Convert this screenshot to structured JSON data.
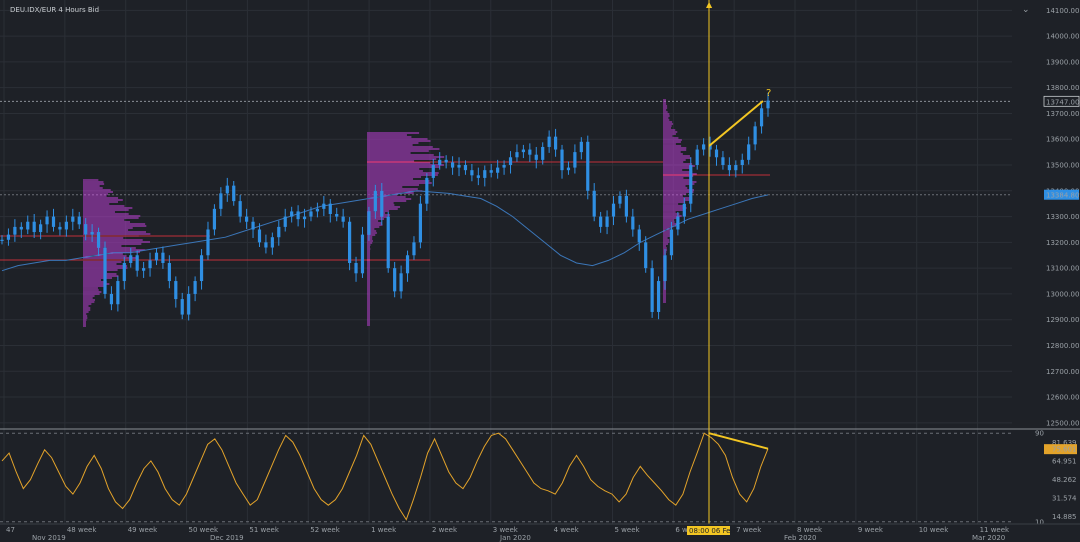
{
  "header": {
    "title": "DEU.IDX/EUR   4 Hours Bid"
  },
  "colors": {
    "background": "#1e2127",
    "grid": "#2b2f36",
    "price": "#2f8fe3",
    "ma": "#3b76b8",
    "volume_profile": "#b23ec9",
    "oscillator": "#e3a32a",
    "annotation": "#f3c623",
    "level_line": "#c0303a"
  },
  "annotation": {
    "question_mark": "?",
    "crosshair_date": "08:00 06 Feb."
  },
  "chart_data": [
    {
      "type": "line",
      "y_ticks": [
        "14100.00",
        "14000.00",
        "13900.00",
        "13800.00",
        "13700.00",
        "13600.00",
        "13500.00",
        "13400.00",
        "13300.00",
        "13200.00",
        "13100.00",
        "13000.00",
        "12900.00",
        "12800.00",
        "12700.00",
        "12600.00",
        "12500.00"
      ],
      "ylim": [
        12480,
        14140
      ],
      "price_labels": {
        "last": "13747.000",
        "ma": "13384.809"
      },
      "x_week_labels": [
        "47",
        "48 week",
        "49 week",
        "50 week",
        "51 week",
        "52 week",
        "1 week",
        "2 week",
        "3 week",
        "4 week",
        "5 week",
        "6 week",
        "7 week",
        "8 week",
        "9 week",
        "10 week",
        "11 week"
      ],
      "x_month_labels": [
        "Nov 2019",
        "Dec 2019",
        "Jan 2020",
        "Feb 2020",
        "Mar 2020"
      ],
      "series": [
        {
          "values": [
            13210,
            13230,
            13260,
            13250,
            13280,
            13240,
            13270,
            13300,
            13260,
            13250,
            13280,
            13300,
            13270,
            13230,
            13240,
            13180,
            13000,
            12960,
            13050,
            13120,
            13150,
            13090,
            13100,
            13130,
            13160,
            13120,
            13050,
            12980,
            12920,
            13000,
            13050,
            13150,
            13250,
            13330,
            13390,
            13420,
            13360,
            13300,
            13280,
            13250,
            13200,
            13180,
            13220,
            13260,
            13300,
            13320,
            13290,
            13300,
            13320,
            13330,
            13350,
            13310,
            13300,
            13280,
            13120,
            13080,
            13230,
            13320,
            13400,
            13300,
            13100,
            13010,
            13080,
            13150,
            13200,
            13350,
            13450,
            13500,
            13520,
            13510,
            13490,
            13500,
            13480,
            13460,
            13450,
            13480,
            13470,
            13490,
            13500,
            13530,
            13550,
            13560,
            13540,
            13520,
            13570,
            13610,
            13560,
            13480,
            13490,
            13550,
            13590,
            13400,
            13300,
            13260,
            13300,
            13350,
            13380,
            13300,
            13250,
            13200,
            13100,
            12930,
            13050,
            13150,
            13250,
            13300,
            13350,
            13500,
            13560,
            13580,
            13560,
            13530,
            13500,
            13480,
            13500,
            13520,
            13580,
            13650,
            13720,
            13750
          ]
        },
        {
          "values": [
            13090,
            13110,
            13120,
            13130,
            13130,
            13140,
            13150,
            13160,
            13160,
            13170,
            13180,
            13190,
            13200,
            13210,
            13220,
            13240,
            13260,
            13280,
            13300,
            13320,
            13340,
            13350,
            13360,
            13370,
            13380,
            13390,
            13400,
            13395,
            13390,
            13380,
            13370,
            13340,
            13300,
            13250,
            13200,
            13150,
            13120,
            13110,
            13130,
            13160,
            13200,
            13230,
            13260,
            13290,
            13310,
            13330,
            13350,
            13370,
            13384
          ]
        }
      ]
    },
    {
      "type": "line",
      "y_ticks": [
        "90",
        "81.639",
        "75.601",
        "64.951",
        "48.262",
        "31.574",
        "14.885",
        "10"
      ],
      "ylim": [
        8,
        92
      ],
      "current_value": "75.601",
      "series": [
        {
          "values": [
            65,
            72,
            55,
            40,
            48,
            62,
            75,
            68,
            55,
            42,
            35,
            45,
            60,
            70,
            58,
            40,
            28,
            22,
            30,
            45,
            58,
            65,
            55,
            40,
            30,
            25,
            35,
            50,
            65,
            80,
            85,
            75,
            60,
            45,
            35,
            25,
            30,
            45,
            60,
            75,
            88,
            82,
            70,
            55,
            40,
            30,
            25,
            30,
            40,
            55,
            70,
            88,
            80,
            65,
            50,
            35,
            22,
            12,
            30,
            50,
            72,
            85,
            70,
            55,
            45,
            40,
            50,
            65,
            78,
            88,
            90,
            85,
            75,
            65,
            55,
            45,
            40,
            38,
            35,
            45,
            60,
            70,
            60,
            48,
            42,
            38,
            35,
            28,
            35,
            50,
            60,
            52,
            45,
            38,
            30,
            25,
            35,
            55,
            72,
            90,
            86,
            80,
            70,
            50,
            35,
            28,
            40,
            60,
            76
          ]
        }
      ]
    }
  ]
}
